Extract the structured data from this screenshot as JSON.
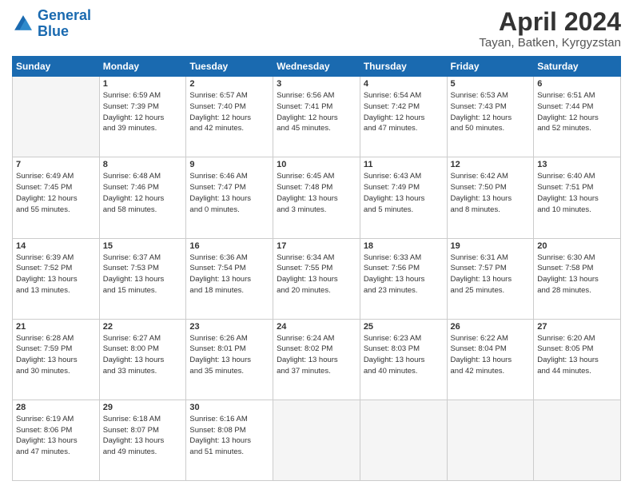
{
  "header": {
    "logo_line1": "General",
    "logo_line2": "Blue",
    "title": "April 2024",
    "subtitle": "Tayan, Batken, Kyrgyzstan"
  },
  "weekdays": [
    "Sunday",
    "Monday",
    "Tuesday",
    "Wednesday",
    "Thursday",
    "Friday",
    "Saturday"
  ],
  "weeks": [
    [
      {
        "num": "",
        "info": ""
      },
      {
        "num": "1",
        "info": "Sunrise: 6:59 AM\nSunset: 7:39 PM\nDaylight: 12 hours\nand 39 minutes."
      },
      {
        "num": "2",
        "info": "Sunrise: 6:57 AM\nSunset: 7:40 PM\nDaylight: 12 hours\nand 42 minutes."
      },
      {
        "num": "3",
        "info": "Sunrise: 6:56 AM\nSunset: 7:41 PM\nDaylight: 12 hours\nand 45 minutes."
      },
      {
        "num": "4",
        "info": "Sunrise: 6:54 AM\nSunset: 7:42 PM\nDaylight: 12 hours\nand 47 minutes."
      },
      {
        "num": "5",
        "info": "Sunrise: 6:53 AM\nSunset: 7:43 PM\nDaylight: 12 hours\nand 50 minutes."
      },
      {
        "num": "6",
        "info": "Sunrise: 6:51 AM\nSunset: 7:44 PM\nDaylight: 12 hours\nand 52 minutes."
      }
    ],
    [
      {
        "num": "7",
        "info": "Sunrise: 6:49 AM\nSunset: 7:45 PM\nDaylight: 12 hours\nand 55 minutes."
      },
      {
        "num": "8",
        "info": "Sunrise: 6:48 AM\nSunset: 7:46 PM\nDaylight: 12 hours\nand 58 minutes."
      },
      {
        "num": "9",
        "info": "Sunrise: 6:46 AM\nSunset: 7:47 PM\nDaylight: 13 hours\nand 0 minutes."
      },
      {
        "num": "10",
        "info": "Sunrise: 6:45 AM\nSunset: 7:48 PM\nDaylight: 13 hours\nand 3 minutes."
      },
      {
        "num": "11",
        "info": "Sunrise: 6:43 AM\nSunset: 7:49 PM\nDaylight: 13 hours\nand 5 minutes."
      },
      {
        "num": "12",
        "info": "Sunrise: 6:42 AM\nSunset: 7:50 PM\nDaylight: 13 hours\nand 8 minutes."
      },
      {
        "num": "13",
        "info": "Sunrise: 6:40 AM\nSunset: 7:51 PM\nDaylight: 13 hours\nand 10 minutes."
      }
    ],
    [
      {
        "num": "14",
        "info": "Sunrise: 6:39 AM\nSunset: 7:52 PM\nDaylight: 13 hours\nand 13 minutes."
      },
      {
        "num": "15",
        "info": "Sunrise: 6:37 AM\nSunset: 7:53 PM\nDaylight: 13 hours\nand 15 minutes."
      },
      {
        "num": "16",
        "info": "Sunrise: 6:36 AM\nSunset: 7:54 PM\nDaylight: 13 hours\nand 18 minutes."
      },
      {
        "num": "17",
        "info": "Sunrise: 6:34 AM\nSunset: 7:55 PM\nDaylight: 13 hours\nand 20 minutes."
      },
      {
        "num": "18",
        "info": "Sunrise: 6:33 AM\nSunset: 7:56 PM\nDaylight: 13 hours\nand 23 minutes."
      },
      {
        "num": "19",
        "info": "Sunrise: 6:31 AM\nSunset: 7:57 PM\nDaylight: 13 hours\nand 25 minutes."
      },
      {
        "num": "20",
        "info": "Sunrise: 6:30 AM\nSunset: 7:58 PM\nDaylight: 13 hours\nand 28 minutes."
      }
    ],
    [
      {
        "num": "21",
        "info": "Sunrise: 6:28 AM\nSunset: 7:59 PM\nDaylight: 13 hours\nand 30 minutes."
      },
      {
        "num": "22",
        "info": "Sunrise: 6:27 AM\nSunset: 8:00 PM\nDaylight: 13 hours\nand 33 minutes."
      },
      {
        "num": "23",
        "info": "Sunrise: 6:26 AM\nSunset: 8:01 PM\nDaylight: 13 hours\nand 35 minutes."
      },
      {
        "num": "24",
        "info": "Sunrise: 6:24 AM\nSunset: 8:02 PM\nDaylight: 13 hours\nand 37 minutes."
      },
      {
        "num": "25",
        "info": "Sunrise: 6:23 AM\nSunset: 8:03 PM\nDaylight: 13 hours\nand 40 minutes."
      },
      {
        "num": "26",
        "info": "Sunrise: 6:22 AM\nSunset: 8:04 PM\nDaylight: 13 hours\nand 42 minutes."
      },
      {
        "num": "27",
        "info": "Sunrise: 6:20 AM\nSunset: 8:05 PM\nDaylight: 13 hours\nand 44 minutes."
      }
    ],
    [
      {
        "num": "28",
        "info": "Sunrise: 6:19 AM\nSunset: 8:06 PM\nDaylight: 13 hours\nand 47 minutes."
      },
      {
        "num": "29",
        "info": "Sunrise: 6:18 AM\nSunset: 8:07 PM\nDaylight: 13 hours\nand 49 minutes."
      },
      {
        "num": "30",
        "info": "Sunrise: 6:16 AM\nSunset: 8:08 PM\nDaylight: 13 hours\nand 51 minutes."
      },
      {
        "num": "",
        "info": ""
      },
      {
        "num": "",
        "info": ""
      },
      {
        "num": "",
        "info": ""
      },
      {
        "num": "",
        "info": ""
      }
    ]
  ]
}
